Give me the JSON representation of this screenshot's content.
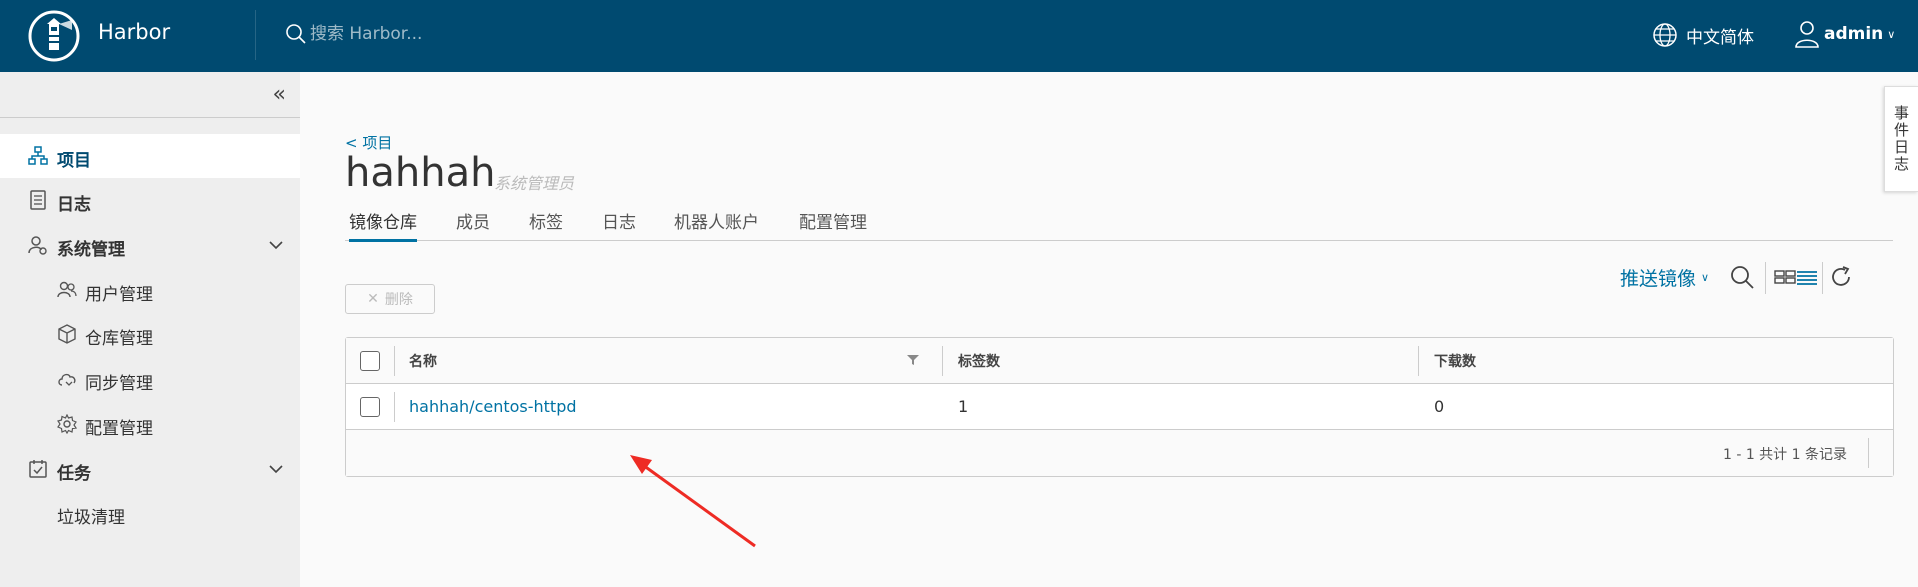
{
  "header": {
    "brand": "Harbor",
    "search_placeholder": "搜索 Harbor...",
    "language": "中文简体",
    "user": "admin"
  },
  "sidebar": {
    "items": [
      {
        "label": "项目",
        "icon": "project-icon",
        "active": true
      },
      {
        "label": "日志",
        "icon": "log-icon"
      },
      {
        "label": "系统管理",
        "icon": "admin-icon",
        "expandable": true
      },
      {
        "label": "用户管理",
        "icon": "users-icon"
      },
      {
        "label": "仓库管理",
        "icon": "registry-icon"
      },
      {
        "label": "同步管理",
        "icon": "cloud-sync-icon"
      },
      {
        "label": "配置管理",
        "icon": "gear-icon"
      },
      {
        "label": "任务",
        "icon": "tasks-icon",
        "expandable": true
      },
      {
        "label": "垃圾清理"
      }
    ]
  },
  "main": {
    "back_link": "< 项目",
    "project_name": "hahhah",
    "role": "系统管理员",
    "tabs": [
      "镜像仓库",
      "成员",
      "标签",
      "日志",
      "机器人账户",
      "配置管理"
    ],
    "active_tab": "镜像仓库",
    "delete_label": "删除",
    "push_label": "推送镜像"
  },
  "table": {
    "columns": [
      "名称",
      "标签数",
      "下载数"
    ],
    "rows": [
      {
        "name": "hahhah/centos-httpd",
        "tags": "1",
        "pulls": "0"
      }
    ],
    "footer": "1 - 1 共计 1 条记录"
  },
  "side_tab": "事件日志",
  "colors": {
    "header_bg": "#004a70",
    "accent": "#0072a3",
    "arrow": "#ee2b24"
  }
}
